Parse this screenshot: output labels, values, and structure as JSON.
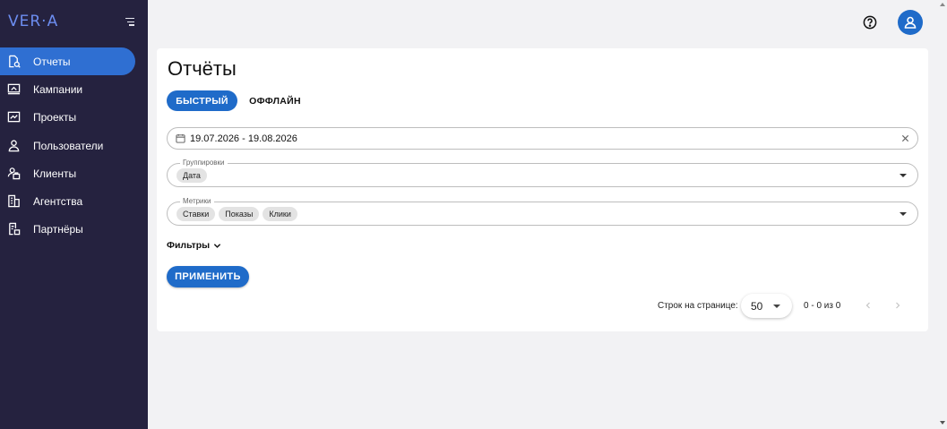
{
  "app": {
    "logo": "VER·A"
  },
  "colors": {
    "sidebar": "#25223f",
    "accent": "#1f6bc9",
    "active_nav": "#2f6fd2",
    "logo": "#6c8df0"
  },
  "sidebar": {
    "items": [
      {
        "label": "Отчеты",
        "icon": "report-icon",
        "active": true
      },
      {
        "label": "Кампании",
        "icon": "campaign-icon",
        "active": false
      },
      {
        "label": "Проекты",
        "icon": "chart-icon",
        "active": false
      },
      {
        "label": "Пользователи",
        "icon": "users-icon",
        "active": false
      },
      {
        "label": "Клиенты",
        "icon": "clients-icon",
        "active": false
      },
      {
        "label": "Агентства",
        "icon": "agency-icon",
        "active": false
      },
      {
        "label": "Партнёры",
        "icon": "partners-icon",
        "active": false
      }
    ]
  },
  "header": {
    "help_icon": "help-icon",
    "user_icon": "user-icon"
  },
  "main": {
    "title": "Отчёты",
    "tabs": [
      {
        "label": "БЫСТРЫЙ",
        "active": true
      },
      {
        "label": "ОФФЛАЙН",
        "active": false
      }
    ],
    "date_range": {
      "value": "19.07.2026 - 19.08.2026"
    },
    "groupings": {
      "label": "Группировки",
      "chips": [
        "Дата"
      ]
    },
    "metrics": {
      "label": "Метрики",
      "chips": [
        "Ставки",
        "Показы",
        "Клики"
      ]
    },
    "filters_label": "Фильтры",
    "apply_label": "ПРИМЕНИТЬ",
    "pagination": {
      "rows_label": "Строк на странице:",
      "rows_value": "50",
      "range": "0 - 0 из 0"
    }
  }
}
